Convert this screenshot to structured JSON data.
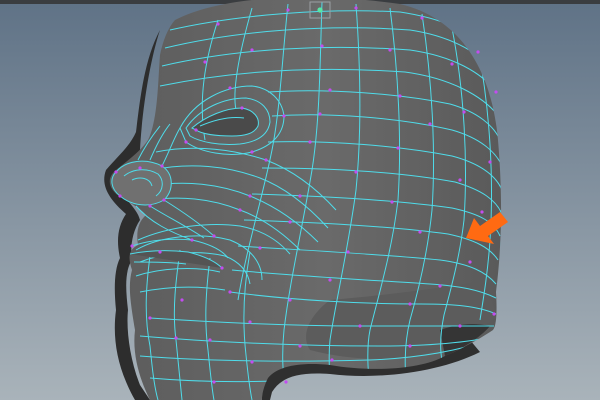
{
  "viewport": {
    "name": "perspective-viewport",
    "background_top": "#5f7286",
    "background_bottom": "#a9b3ba"
  },
  "model": {
    "name": "head-mesh",
    "shade_color": "#646464",
    "shade_dark": "#3c3c3c",
    "wire_color": "#4fdcea",
    "vertex_color": "#c34cf0",
    "component_selection_color": "#58e6a6"
  },
  "annotation": {
    "icon": "arrow-pointer-icon",
    "color": "#ff6a12"
  }
}
